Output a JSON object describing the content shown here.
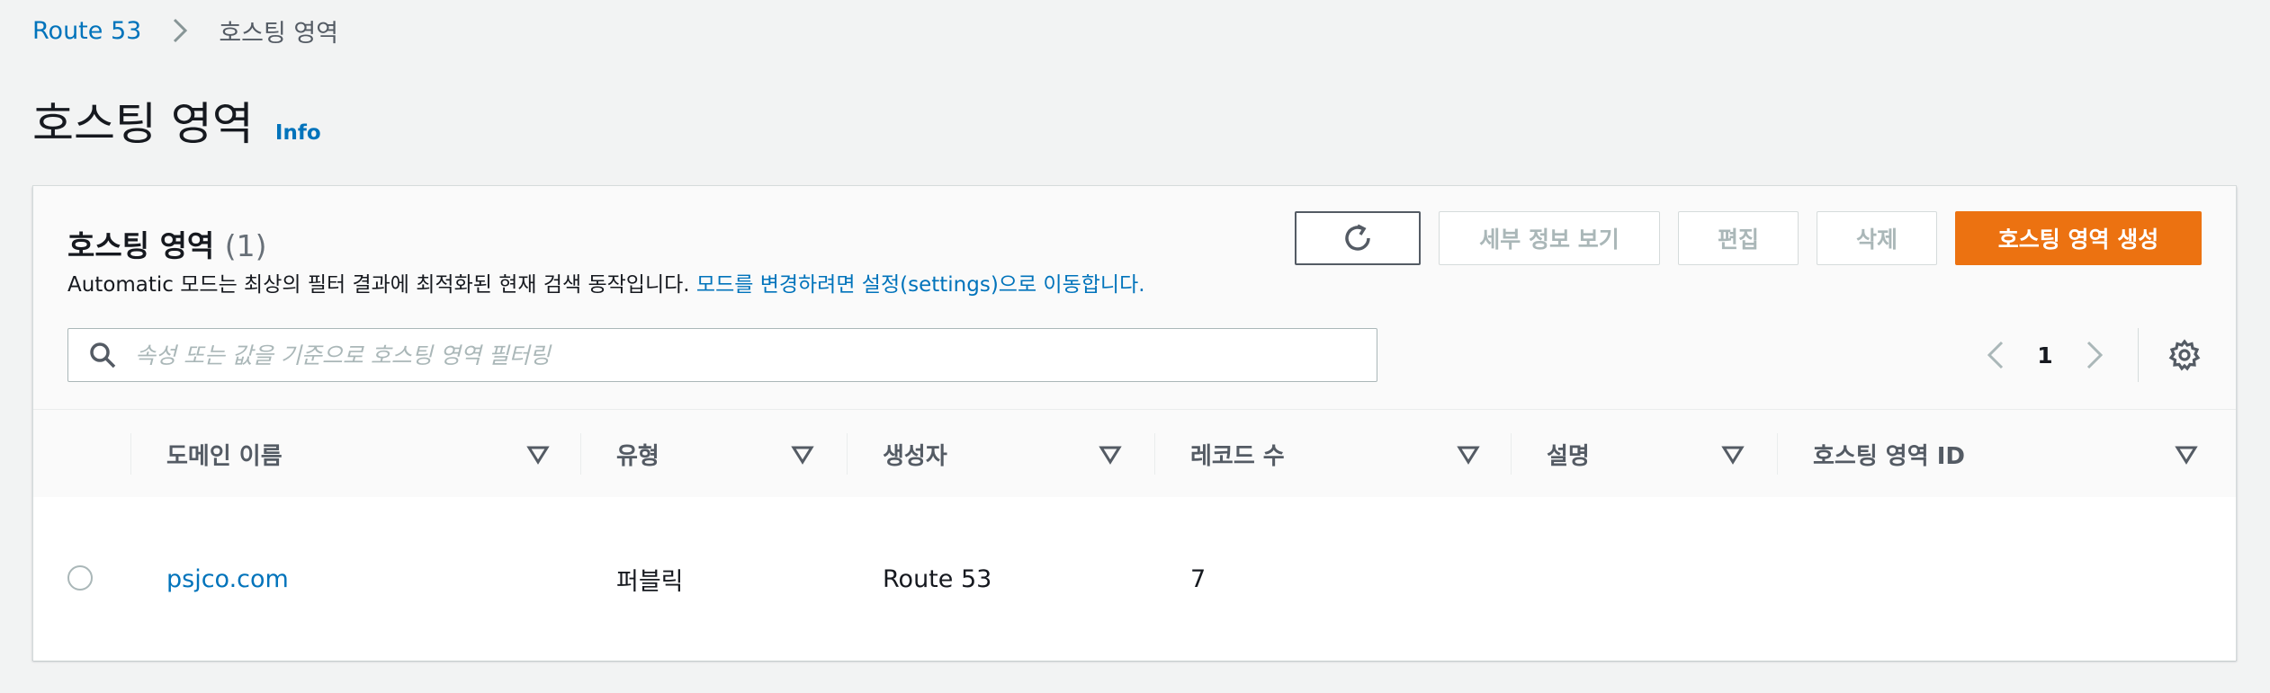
{
  "breadcrumb": {
    "root": "Route 53",
    "current": "호스팅 영역"
  },
  "page": {
    "title": "호스팅 영역",
    "info": "Info"
  },
  "panel": {
    "title": "호스팅 영역",
    "count": "(1)",
    "description": "Automatic 모드는 최상의 필터 결과에 최적화된 현재 검색 동작입니다.",
    "description_link": "모드를 변경하려면 설정(settings)으로 이동합니다."
  },
  "actions": {
    "refresh_icon": "refresh-icon",
    "details": "세부 정보 보기",
    "edit": "편집",
    "delete": "삭제",
    "create": "호스팅 영역 생성"
  },
  "search": {
    "placeholder": "속성 또는 값을 기준으로 호스팅 영역 필터링",
    "value": ""
  },
  "pagination": {
    "current_page": "1"
  },
  "table": {
    "columns": [
      "도메인 이름",
      "유형",
      "생성자",
      "레코드 수",
      "설명",
      "호스팅 영역 ID"
    ],
    "rows": [
      {
        "domain": "psjco.com",
        "type": "퍼블릭",
        "created_by": "Route 53",
        "record_count": "7",
        "description": "",
        "zone_id": ""
      }
    ]
  },
  "colors": {
    "link": "#0073bb",
    "primary": "#ec7211",
    "text": "#16191f",
    "muted": "#545b64",
    "disabled": "#aab7b8",
    "background": "#f2f3f3"
  }
}
